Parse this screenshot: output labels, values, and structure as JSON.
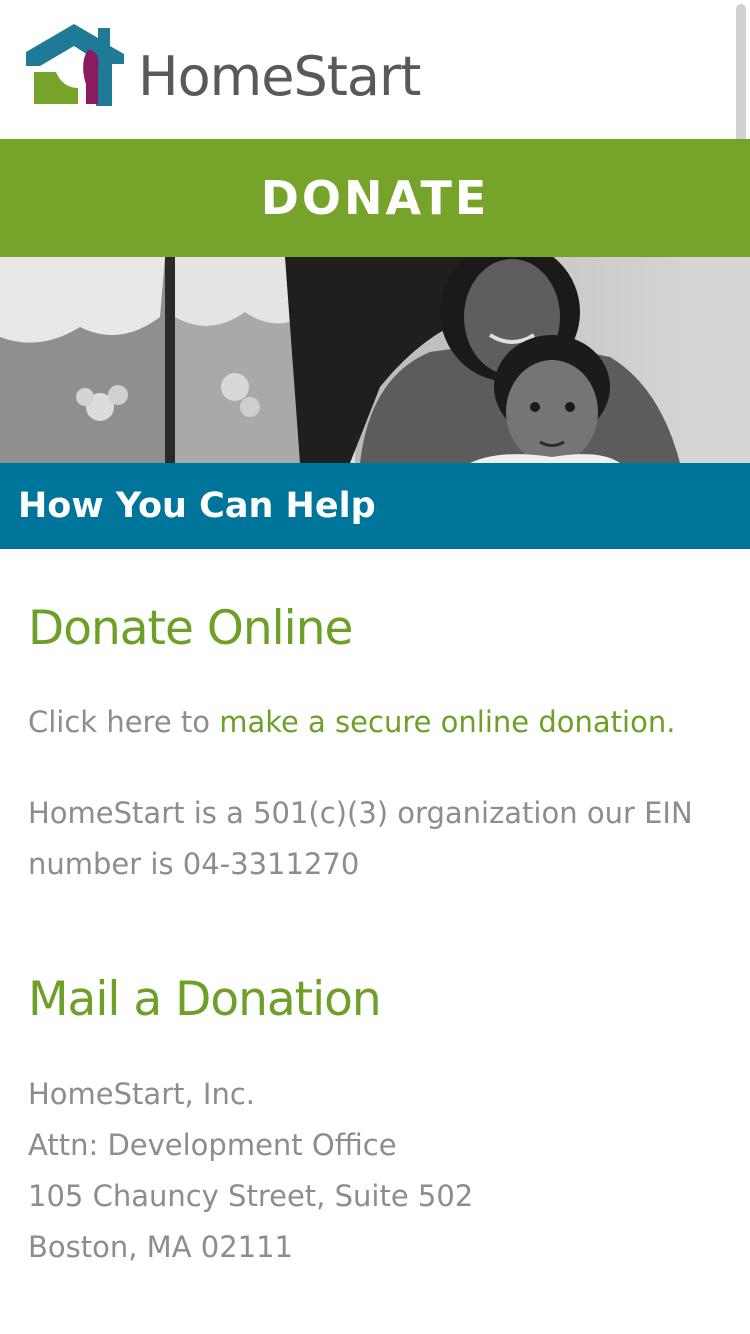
{
  "header": {
    "brand_name": "HomeStart",
    "brand_colors": {
      "house": "#1e7a96",
      "figure_green": "#76a42a",
      "figure_purple": "#8a1b5f",
      "text": "#58595b"
    }
  },
  "banner": {
    "title": "DONATE",
    "color": "#76a42a"
  },
  "hero_photo": {
    "icon": "family-photo"
  },
  "section": {
    "title": "How You Can Help",
    "color": "#00759c"
  },
  "donate_online": {
    "heading": "Donate Online",
    "lead_text": "Click here to ",
    "link_text": "make a secure online donation.",
    "ein_line1": "HomeStart is a 501(c)(3) organization our EIN",
    "ein_line2": "number is 04-3311270"
  },
  "mail_donation": {
    "heading": "Mail a Donation",
    "address": [
      "HomeStart, Inc.",
      "Attn: Development Office",
      "105 Chauncy Street, Suite 502",
      "Boston, MA 02111"
    ]
  }
}
